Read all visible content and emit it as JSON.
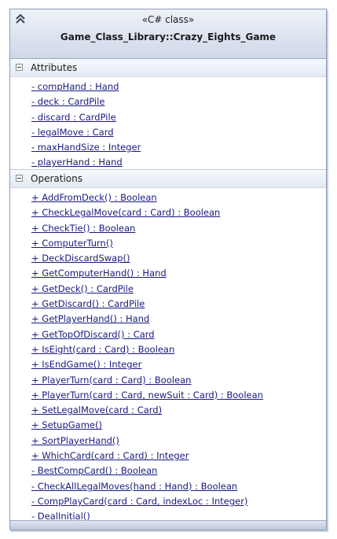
{
  "class": {
    "stereotype": "«C# class»",
    "name": "Game_Class_Library::Crazy_Eights_Game"
  },
  "attributes": {
    "title": "Attributes",
    "items": [
      "- compHand : Hand",
      "- deck : CardPile",
      "- discard : CardPile",
      "- legalMove : Card",
      "- maxHandSize : Integer",
      "- playerHand : Hand"
    ]
  },
  "operations": {
    "title": "Operations",
    "items": [
      "+ AddFromDeck() : Boolean",
      "+ CheckLegalMove(card : Card) : Boolean",
      "+ CheckTie() : Boolean",
      "+ ComputerTurn()",
      "+ DeckDiscardSwap()",
      "+ GetComputerHand() : Hand",
      "+ GetDeck() : CardPile",
      "+ GetDiscard() : CardPile",
      "+ GetPlayerHand() : Hand",
      "+ GetTopOfDiscard() : Card",
      "+ IsEight(card : Card) : Boolean",
      "+ IsEndGame() : Integer",
      "+ PlayerTurn(card : Card) : Boolean",
      "+ PlayerTurn(card : Card, newSuit : Card) : Boolean",
      "+ SetLegalMove(card : Card)",
      "+ SetupGame()",
      "+ SortPlayerHand()",
      "+ WhichCard(card : Card) : Integer",
      "- BestCompCard() : Boolean",
      "- CheckAllLegalMoves(hand : Hand) : Boolean",
      "- CompPlayCard(card : Card, indexLoc : Integer)",
      "- DealInitial()"
    ]
  },
  "icons": {
    "collapse": "double-chevron-up-icon",
    "section_toggle": "minus-box-icon"
  },
  "colors": {
    "member_text": "#1a1a80",
    "header_gradient_top": "#eef2f8",
    "header_gradient_bottom": "#cfd8e8",
    "border": "#8c9cb8"
  }
}
